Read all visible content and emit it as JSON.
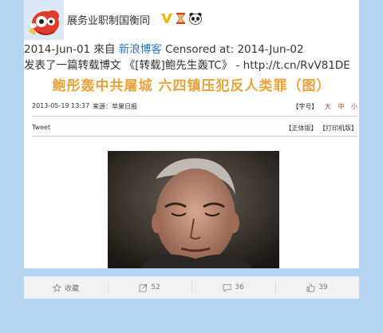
{
  "post": {
    "username": "展务业职制国衡同",
    "date": "2014-Jun-01",
    "from_label": "來自",
    "source": "新浪博客",
    "censored_label": "Censored at:",
    "censored_date": "2014-Jun-02",
    "text": "发表了一篇转载博文 《[转载]鲍先生轰TC》 - http://t.cn/RvV81DE"
  },
  "article": {
    "title": "鲍彤轰中共屠城 六四镇压犯反人类罪（图）",
    "datetime": "2013-05-19 13:37",
    "source": "来源：苹果日报",
    "font_label": "【字号】",
    "font_sizes": [
      "大",
      "中",
      "小"
    ],
    "tweet": "Tweet",
    "links": "【正体版】 【打印机版】"
  },
  "actions": [
    {
      "icon": "star-icon",
      "label": "收藏"
    },
    {
      "icon": "forward-icon",
      "label": "52"
    },
    {
      "icon": "comment-icon",
      "label": "36"
    },
    {
      "icon": "thumbs-up-icon",
      "label": "39"
    }
  ],
  "colors": {
    "page_bg": "#b7d4f2",
    "link": "#2a78c5",
    "title": "#e8a23a"
  }
}
